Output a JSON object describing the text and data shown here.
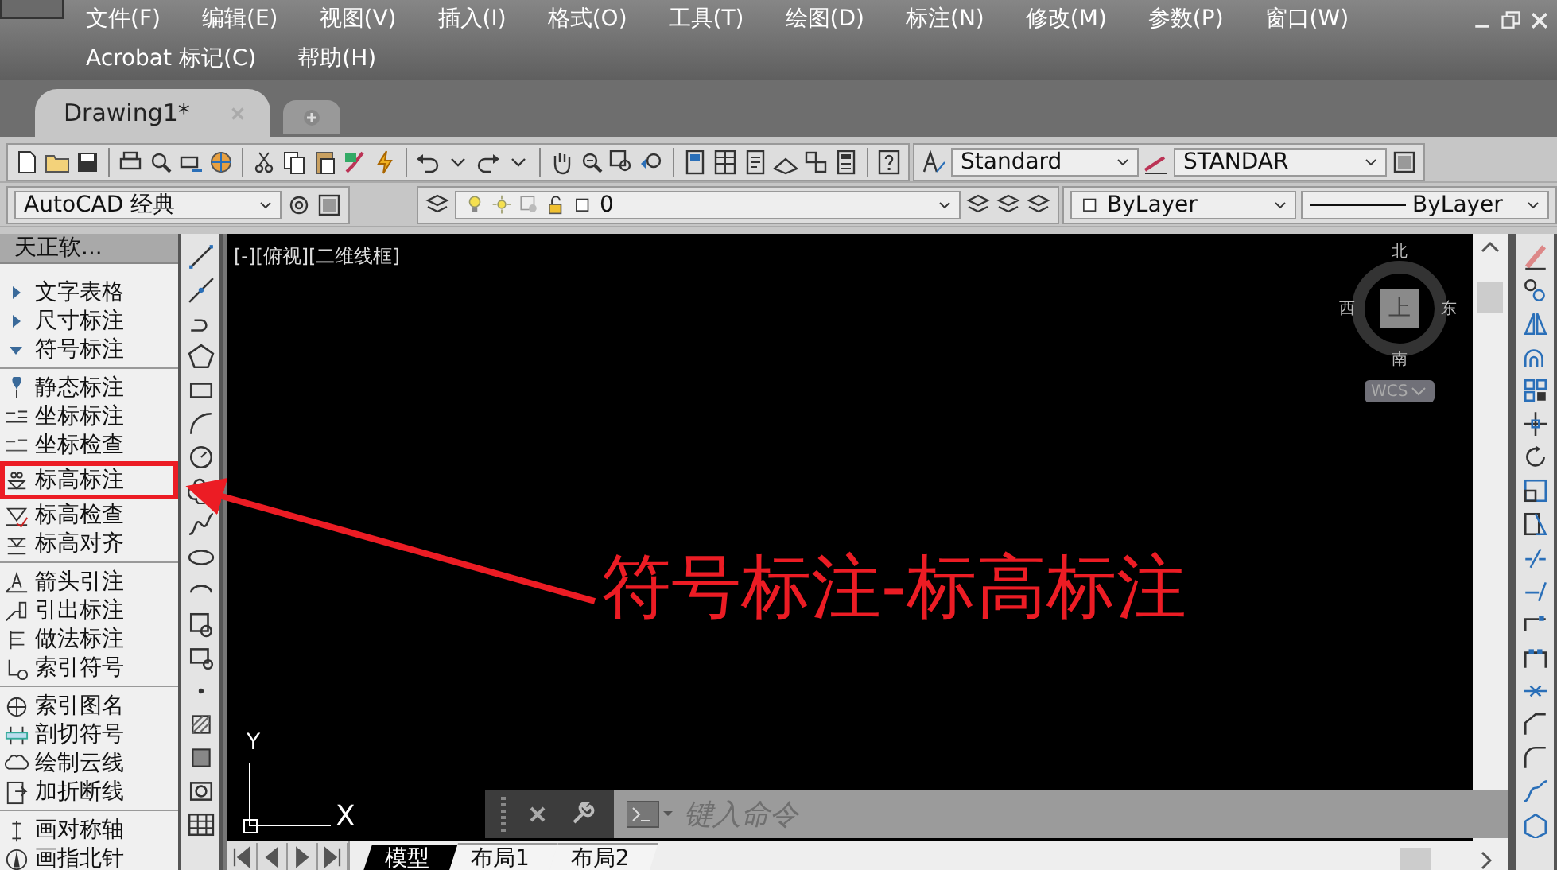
{
  "menu_rows": [
    [
      "文件(F)",
      "编辑(E)",
      "视图(V)",
      "插入(I)",
      "格式(O)",
      "工具(T)",
      "绘图(D)",
      "标注(N)",
      "修改(M)",
      "参数(P)",
      "窗口(W)"
    ],
    [
      "Acrobat 标记(C)",
      "帮助(H)"
    ]
  ],
  "document_tabs": [
    {
      "label": "Drawing1*",
      "selected": true
    }
  ],
  "toolbar": {
    "text_style": "Standard",
    "dim_style": "STANDAR",
    "workspace": "AutoCAD 经典",
    "layer": "0",
    "color_control": "ByLayer",
    "linetype": "ByLayer"
  },
  "palette": {
    "title": "天正软...",
    "categories": [
      {
        "label": "文字表格",
        "expanded": false
      },
      {
        "label": "尺寸标注",
        "expanded": false
      },
      {
        "label": "符号标注",
        "expanded": true,
        "children": [
          [
            {
              "label": "静态标注",
              "highlighted": false
            },
            {
              "label": "坐标标注",
              "highlighted": false
            },
            {
              "label": "坐标检查",
              "highlighted": false
            },
            {
              "label": "标高标注",
              "highlighted": true
            },
            {
              "label": "标高检查",
              "highlighted": false
            },
            {
              "label": "标高对齐",
              "highlighted": false
            }
          ],
          [
            {
              "label": "箭头引注",
              "highlighted": false
            },
            {
              "label": "引出标注",
              "highlighted": false
            },
            {
              "label": "做法标注",
              "highlighted": false
            },
            {
              "label": "索引符号",
              "highlighted": false
            }
          ],
          [
            {
              "label": "索引图名",
              "highlighted": false
            },
            {
              "label": "剖切符号",
              "highlighted": false
            },
            {
              "label": "绘制云线",
              "highlighted": false
            },
            {
              "label": "加折断线",
              "highlighted": false
            }
          ],
          [
            {
              "label": "画对称轴",
              "highlighted": false
            },
            {
              "label": "画指北针",
              "highlighted": false
            }
          ]
        ]
      }
    ]
  },
  "viewport": {
    "controls_label": "[-][俯视][二维线框]"
  },
  "view_cube": {
    "north": "北",
    "south": "南",
    "west": "西",
    "east": "东",
    "face": "上",
    "ucs_menu": "WCS"
  },
  "ucs_icon": {
    "y_label": "Y",
    "x_label": "X"
  },
  "command_line": {
    "placeholder": "键入命令"
  },
  "layout_tabs": [
    {
      "label": "模型",
      "selected": true
    },
    {
      "label": "布局1",
      "selected": false
    },
    {
      "label": "布局2",
      "selected": false
    }
  ],
  "annotation": {
    "text": "符号标注-标高标注"
  }
}
